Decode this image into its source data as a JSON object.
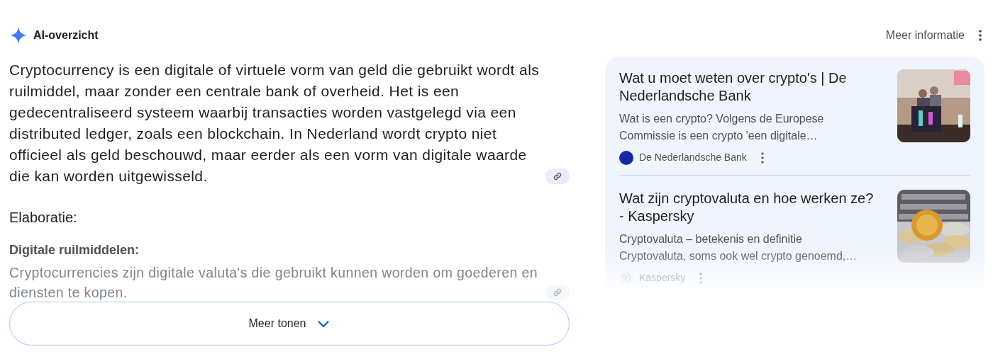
{
  "header": {
    "title": "AI-overzicht",
    "more_link": "Meer informatie"
  },
  "summary": {
    "text": "Cryptocurrency is een digitale of virtuele vorm van geld die gebruikt wordt als ruilmiddel, maar zonder een centrale bank of overheid. Het is een gedecentraliseerd systeem waarbij transacties worden vastgelegd via een distributed ledger, zoals een blockchain. In Nederland wordt crypto niet officieel als geld beschouwd, maar eerder als een vorm van digitale waarde die kan worden uitgewisseld."
  },
  "section_heading": "Elaboratie:",
  "subsection": {
    "heading": "Digitale ruilmiddelen:",
    "text": "Cryptocurrencies zijn digitale valuta's die gebruikt kunnen worden om goederen en diensten te kopen."
  },
  "show_more_button": "Meer tonen",
  "sources": [
    {
      "title": "Wat u moet weten over crypto's | De Nederlandsche Bank",
      "snippet_lines": [
        "Wat is een crypto? Volgens de Europese",
        "Commissie is een crypto 'een digitale…"
      ],
      "source": "De Nederlandsche Bank",
      "favicon": {
        "kind": "dot",
        "color": "#1428a8"
      }
    },
    {
      "title": "Wat zijn cryptovaluta en hoe werken ze? - Kaspersky",
      "snippet_lines": [
        "Cryptovaluta – betekenis en definitie",
        "Cryptovaluta, soms ook wel crypto genoemd,…"
      ],
      "source": "Kaspersky",
      "favicon": {
        "kind": "globe"
      }
    }
  ]
}
